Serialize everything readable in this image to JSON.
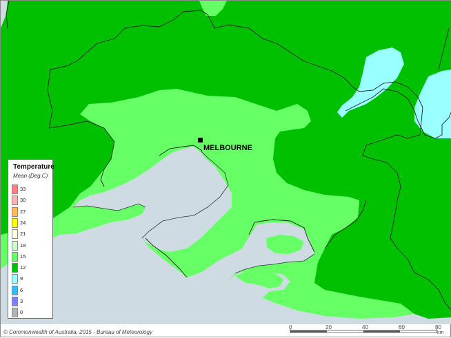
{
  "map": {
    "city": {
      "name": "MELBOURNE"
    },
    "colors": {
      "water": "#cfdbe2",
      "zone_15_18": "#66ff66",
      "zone_12_15": "#00c000",
      "zone_9_12": "#99ffff",
      "boundary": "#202020"
    }
  },
  "legend": {
    "title": "Temperature",
    "subtitle": "Mean (Deg C)",
    "items": [
      {
        "label": "33",
        "color": "#ff8080"
      },
      {
        "label": "30",
        "color": "#ffb4b4"
      },
      {
        "label": "27",
        "color": "#ffbb55"
      },
      {
        "label": "24",
        "color": "#ffff00"
      },
      {
        "label": "21",
        "color": "#ffffe0"
      },
      {
        "label": "18",
        "color": "#ccffcc"
      },
      {
        "label": "15",
        "color": "#66ff66"
      },
      {
        "label": "12",
        "color": "#00c000"
      },
      {
        "label": "9",
        "color": "#99ffff"
      },
      {
        "label": "6",
        "color": "#33bbff"
      },
      {
        "label": "3",
        "color": "#8080ff"
      },
      {
        "label": "0",
        "color": "#b4b4b4"
      }
    ]
  },
  "footer": {
    "copyright": "© Commonwealth of Australia, 2015 - Bureau of Meteorology",
    "scale": {
      "ticks": [
        "0",
        "20",
        "40",
        "60",
        "80"
      ],
      "unit": "km"
    }
  }
}
